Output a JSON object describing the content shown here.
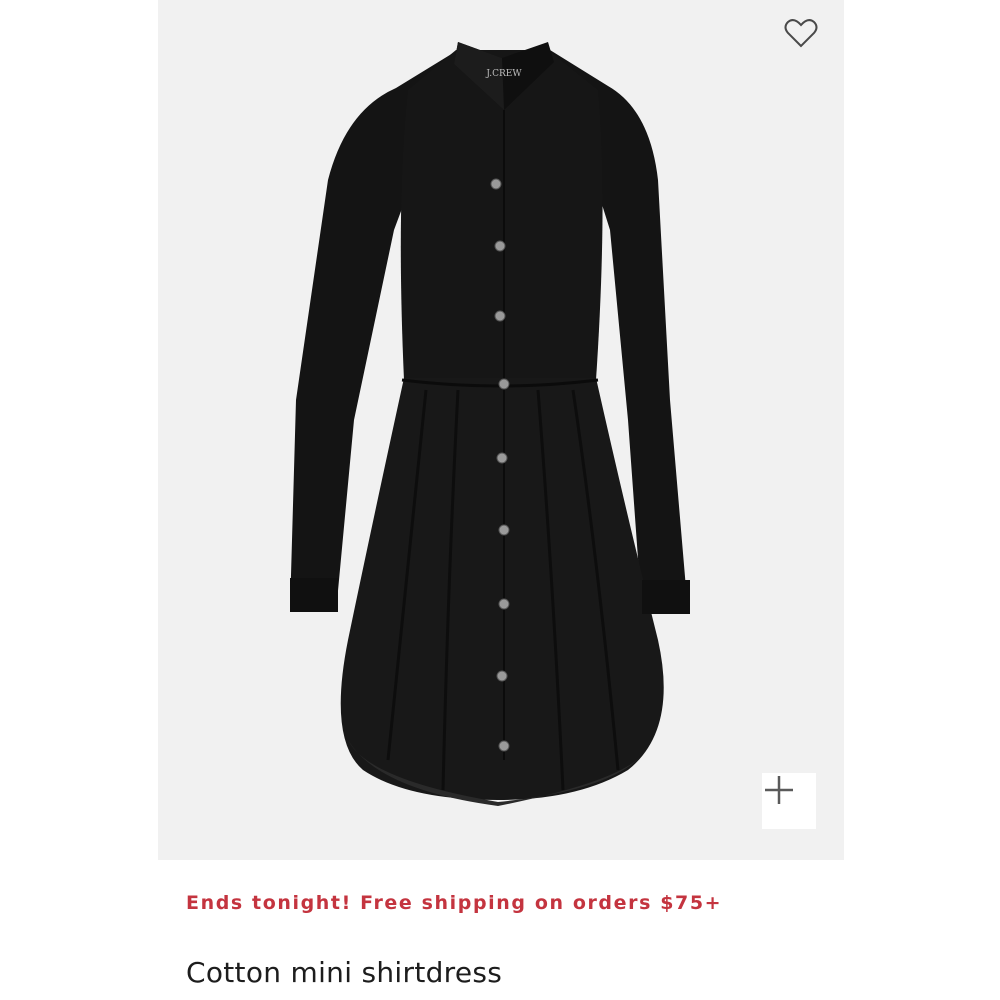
{
  "product": {
    "brand_label": "J.CREW",
    "promo_text": "Ends tonight! Free shipping on orders $75+",
    "title": "Cotton mini shirtdress"
  },
  "icons": {
    "wishlist": "heart-outline-icon",
    "zoom": "plus-icon"
  },
  "colors": {
    "promo": "#c4343f",
    "image_background": "#f1f1f1",
    "dress": "#151515"
  }
}
